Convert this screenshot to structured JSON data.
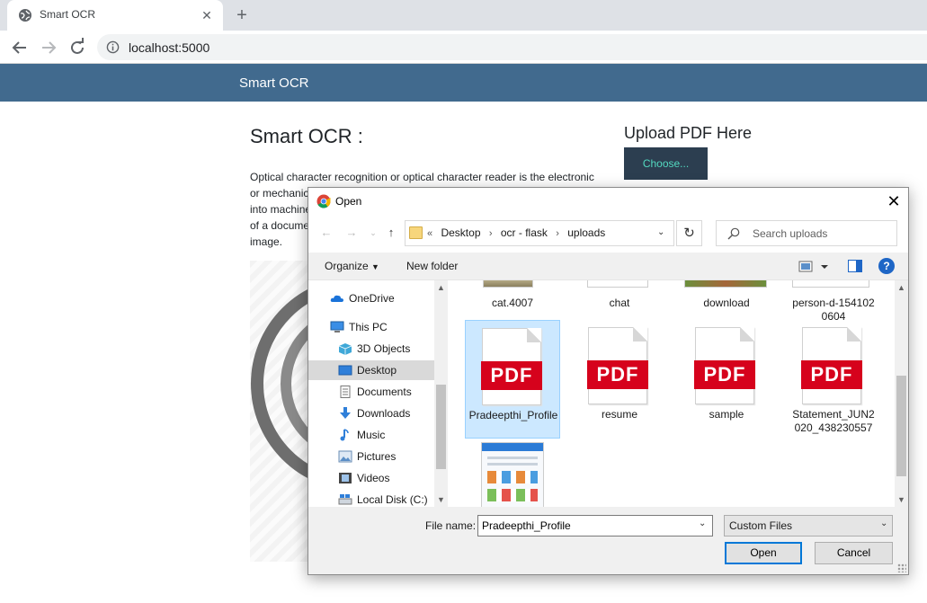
{
  "browser": {
    "tab_title": "Smart OCR",
    "url": "localhost:5000"
  },
  "page": {
    "brand": "Smart OCR",
    "heading": "Smart OCR :",
    "description": "Optical character recognition or optical character reader is the electronic or mechanical conversion of images of typed, handwritten or printed text into machine-encoded text, whether from a scanned document, a photo of a document, a scene-photo or from subtitle text superimposed on an image.",
    "upload_heading": "Upload PDF Here",
    "choose_label": "Choose..."
  },
  "dialog": {
    "title": "Open",
    "breadcrumb": {
      "prefix": "«",
      "items": [
        "Desktop",
        "ocr - flask",
        "uploads"
      ]
    },
    "search_placeholder": "Search uploads",
    "toolbar": {
      "organize": "Organize",
      "new_folder": "New folder"
    },
    "nav_items": [
      {
        "label": "OneDrive",
        "icon": "cloud-icon"
      },
      {
        "label": "This PC",
        "icon": "computer-icon"
      },
      {
        "label": "3D Objects",
        "icon": "cube-icon"
      },
      {
        "label": "Desktop",
        "icon": "desktop-icon",
        "selected": true
      },
      {
        "label": "Documents",
        "icon": "documents-icon"
      },
      {
        "label": "Downloads",
        "icon": "download-arrow-icon"
      },
      {
        "label": "Music",
        "icon": "music-note-icon"
      },
      {
        "label": "Pictures",
        "icon": "pictures-icon"
      },
      {
        "label": "Videos",
        "icon": "film-icon"
      },
      {
        "label": "Local Disk (C:)",
        "icon": "drive-icon"
      }
    ],
    "files_top": [
      "cat.4007",
      "chat",
      "download",
      "person-d-1541020604"
    ],
    "files": [
      {
        "name": "Pradeepthi_Profile",
        "type": "pdf",
        "selected": true
      },
      {
        "name": "resume",
        "type": "pdf"
      },
      {
        "name": "sample",
        "type": "pdf"
      },
      {
        "name": "Statement_JUN2020_438230557",
        "type": "pdf"
      }
    ],
    "pdf_badge": "PDF",
    "file_name_label": "File name:",
    "file_name_value": "Pradeepthi_Profile",
    "filter_value": "Custom Files",
    "open_label": "Open",
    "cancel_label": "Cancel"
  }
}
